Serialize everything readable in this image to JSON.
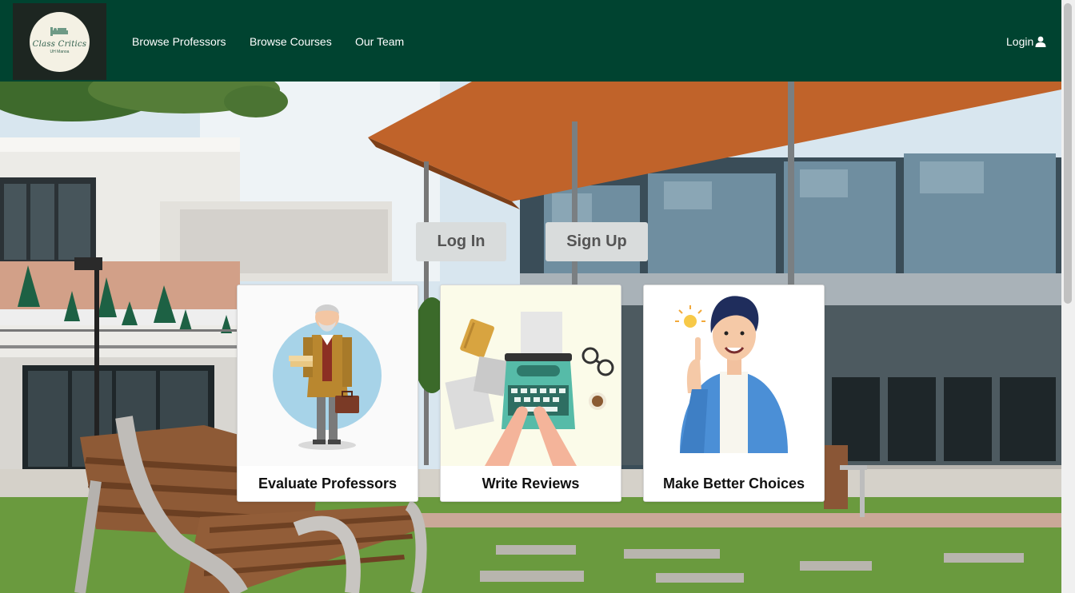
{
  "logo": {
    "title": "Class Critics",
    "subtitle": "UH Manoa"
  },
  "nav": {
    "links": [
      "Browse Professors",
      "Browse Courses",
      "Our Team"
    ],
    "login_label": "Login"
  },
  "hero": {
    "login_button": "Log In",
    "signup_button": "Sign Up",
    "cards": [
      {
        "caption": "Evaluate Professors",
        "icon": "professor-illustration"
      },
      {
        "caption": "Write Reviews",
        "icon": "typewriter-illustration"
      },
      {
        "caption": "Make Better Choices",
        "icon": "idea-person-illustration"
      }
    ]
  },
  "colors": {
    "navbar": "#004330",
    "logo_bg": "#1d2621",
    "button_bg": "#d9dcdc"
  }
}
